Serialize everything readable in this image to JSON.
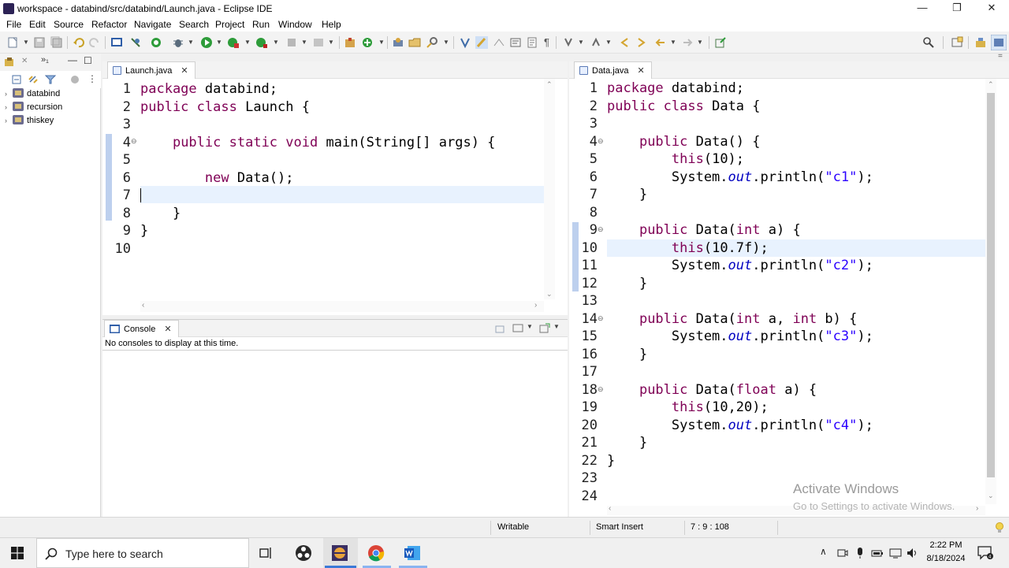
{
  "window": {
    "title": "workspace - databind/src/databind/Launch.java - Eclipse IDE",
    "minimize": "—",
    "maximize": "❐",
    "close": "✕"
  },
  "menu": [
    "File",
    "Edit",
    "Source",
    "Refactor",
    "Navigate",
    "Search",
    "Project",
    "Run",
    "Window",
    "Help"
  ],
  "explorer": {
    "projects": [
      {
        "name": "databind"
      },
      {
        "name": "recursion"
      },
      {
        "name": "thiskey"
      }
    ]
  },
  "left_editor": {
    "tab": "Launch.java",
    "lines": [
      "1",
      "2",
      "3",
      "4",
      "5",
      "6",
      "7",
      "8",
      "9",
      "10"
    ]
  },
  "right_editor": {
    "tab": "Data.java",
    "lines": [
      "1",
      "2",
      "3",
      "4",
      "5",
      "6",
      "7",
      "8",
      "9",
      "10",
      "11",
      "12",
      "13",
      "14",
      "15",
      "16",
      "17",
      "18",
      "19",
      "20",
      "21",
      "22",
      "23",
      "24"
    ]
  },
  "console": {
    "tab": "Console",
    "message": "No consoles to display at this time."
  },
  "status": {
    "writable": "Writable",
    "mode": "Smart Insert",
    "position": "7 : 9 : 108"
  },
  "watermark": {
    "title": "Activate Windows",
    "subtitle": "Go to Settings to activate Windows."
  },
  "taskbar": {
    "search_placeholder": "Type here to search",
    "time": "2:22 PM",
    "date": "8/18/2024"
  },
  "colors": {
    "keyword": "#7f0055",
    "static_field": "#0000c0",
    "string": "#2a00ff",
    "current_line": "#e8f2fe"
  }
}
